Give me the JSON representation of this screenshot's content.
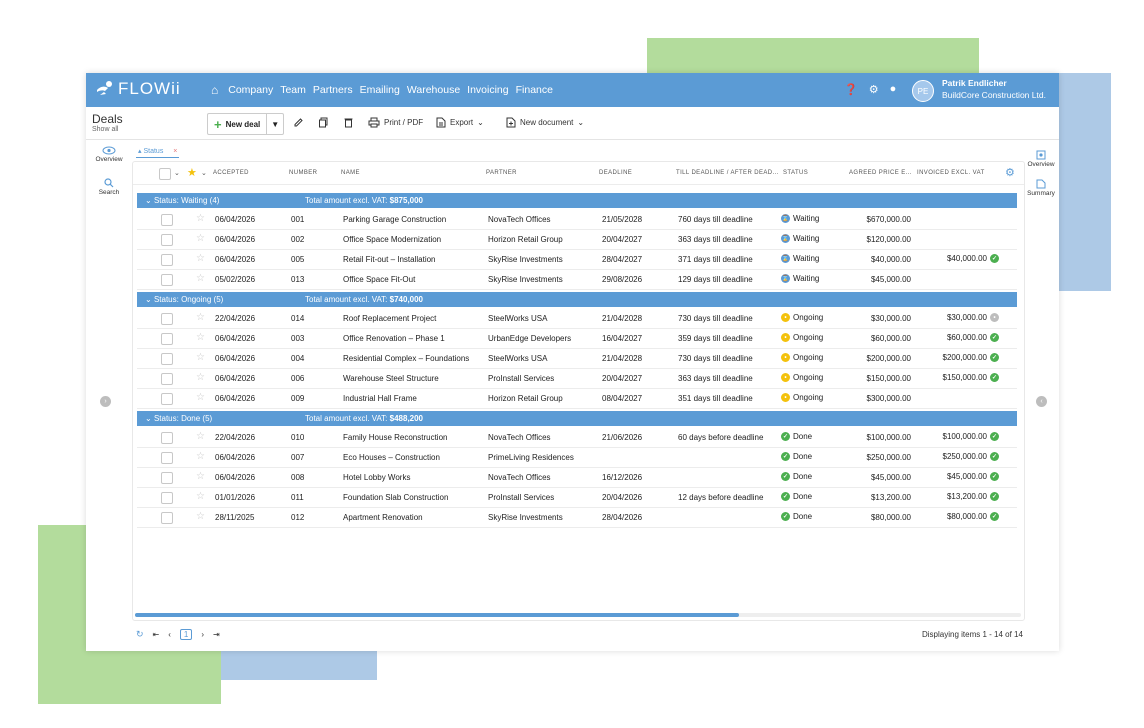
{
  "app": {
    "logo": "FLOWii"
  },
  "nav": {
    "items": [
      "Company",
      "Team",
      "Partners",
      "Emailing",
      "Warehouse",
      "Invoicing",
      "Finance"
    ]
  },
  "user": {
    "initials": "PE",
    "name": "Patrik Endlicher",
    "company": "BuildCore Construction Ltd."
  },
  "toolbar": {
    "title": "Deals",
    "subtitle": "Show all",
    "new_deal": "New deal",
    "print": "Print / PDF",
    "export": "Export",
    "new_document": "New document"
  },
  "leftrail": {
    "overview": "Overview",
    "search": "Search"
  },
  "rightrail": {
    "overview": "Overview",
    "summary": "Summary"
  },
  "filter": {
    "label": "Status",
    "remove": "×"
  },
  "columns": [
    "ACCEPTED",
    "NUMBER",
    "NAME",
    "PARTNER",
    "DEADLINE",
    "TILL DEADLINE / AFTER DEAD...",
    "STATUS",
    "AGREED PRICE E...",
    "INVOICED EXCL. VAT"
  ],
  "groups": [
    {
      "title": "Status: Waiting (4)",
      "total_label": "Total amount excl. VAT:",
      "total_value": "$875,000",
      "rows": [
        {
          "accepted": "06/04/2026",
          "number": "001",
          "name": "Parking Garage Construction",
          "partner": "NovaTech Offices",
          "deadline": "21/05/2028",
          "till": "760 days till deadline",
          "status": "Waiting",
          "price": "$670,000.00",
          "invoiced": ""
        },
        {
          "accepted": "06/04/2026",
          "number": "002",
          "name": "Office Space Modernization",
          "partner": "Horizon Retail Group",
          "deadline": "20/04/2027",
          "till": "363 days till deadline",
          "status": "Waiting",
          "price": "$120,000.00",
          "invoiced": ""
        },
        {
          "accepted": "06/04/2026",
          "number": "005",
          "name": "Retail Fit-out – Installation",
          "partner": "SkyRise Investments",
          "deadline": "28/04/2027",
          "till": "371 days till deadline",
          "status": "Waiting",
          "price": "$40,000.00",
          "invoiced": "$40,000.00"
        },
        {
          "accepted": "05/02/2026",
          "number": "013",
          "name": "Office Space Fit-Out",
          "partner": "SkyRise Investments",
          "deadline": "29/08/2026",
          "till": "129 days till deadline",
          "status": "Waiting",
          "price": "$45,000.00",
          "invoiced": ""
        }
      ]
    },
    {
      "title": "Status: Ongoing (5)",
      "total_label": "Total amount excl. VAT:",
      "total_value": "$740,000",
      "rows": [
        {
          "accepted": "22/04/2026",
          "number": "014",
          "name": "Roof Replacement Project",
          "partner": "SteelWorks USA",
          "deadline": "21/04/2028",
          "till": "730 days till deadline",
          "status": "Ongoing",
          "price": "$30,000.00",
          "invoiced": "$30,000.00"
        },
        {
          "accepted": "06/04/2026",
          "number": "003",
          "name": "Office Renovation – Phase 1",
          "partner": "UrbanEdge Developers",
          "deadline": "16/04/2027",
          "till": "359 days till deadline",
          "status": "Ongoing",
          "price": "$60,000.00",
          "invoiced": "$60,000.00"
        },
        {
          "accepted": "06/04/2026",
          "number": "004",
          "name": "Residential Complex – Foundations",
          "partner": "SteelWorks USA",
          "deadline": "21/04/2028",
          "till": "730 days till deadline",
          "status": "Ongoing",
          "price": "$200,000.00",
          "invoiced": "$200,000.00"
        },
        {
          "accepted": "06/04/2026",
          "number": "006",
          "name": "Warehouse Steel Structure",
          "partner": "ProInstall Services",
          "deadline": "20/04/2027",
          "till": "363 days till deadline",
          "status": "Ongoing",
          "price": "$150,000.00",
          "invoiced": "$150,000.00"
        },
        {
          "accepted": "06/04/2026",
          "number": "009",
          "name": "Industrial Hall Frame",
          "partner": "Horizon Retail Group",
          "deadline": "08/04/2027",
          "till": "351 days till deadline",
          "status": "Ongoing",
          "price": "$300,000.00",
          "invoiced": ""
        }
      ]
    },
    {
      "title": "Status: Done (5)",
      "total_label": "Total amount excl. VAT:",
      "total_value": "$488,200",
      "rows": [
        {
          "accepted": "22/04/2026",
          "number": "010",
          "name": "Family House Reconstruction",
          "partner": "NovaTech Offices",
          "deadline": "21/06/2026",
          "till": "60 days before deadline",
          "status": "Done",
          "price": "$100,000.00",
          "invoiced": "$100,000.00"
        },
        {
          "accepted": "06/04/2026",
          "number": "007",
          "name": "Eco Houses – Construction",
          "partner": "PrimeLiving Residences",
          "deadline": "",
          "till": "",
          "status": "Done",
          "price": "$250,000.00",
          "invoiced": "$250,000.00"
        },
        {
          "accepted": "06/04/2026",
          "number": "008",
          "name": "Hotel Lobby Works",
          "partner": "NovaTech Offices",
          "deadline": "16/12/2026",
          "till": "",
          "status": "Done",
          "price": "$45,000.00",
          "invoiced": "$45,000.00"
        },
        {
          "accepted": "01/01/2026",
          "number": "011",
          "name": "Foundation Slab Construction",
          "partner": "ProInstall Services",
          "deadline": "20/04/2026",
          "till": "12 days before deadline",
          "status": "Done",
          "price": "$13,200.00",
          "invoiced": "$13,200.00"
        },
        {
          "accepted": "28/11/2025",
          "number": "012",
          "name": "Apartment Renovation",
          "partner": "SkyRise Investments",
          "deadline": "28/04/2026",
          "till": "",
          "status": "Done",
          "price": "$80,000.00",
          "invoiced": "$80,000.00"
        }
      ]
    }
  ],
  "pager": {
    "current_page": "1",
    "displaying": "Displaying items 1 - 14 of 14"
  },
  "colors": {
    "accent": "#5b9bd5",
    "waiting": "#5b9bd5",
    "ongoing": "#f4c20d",
    "done": "#4caf50",
    "grey": "#bdbdbd"
  }
}
